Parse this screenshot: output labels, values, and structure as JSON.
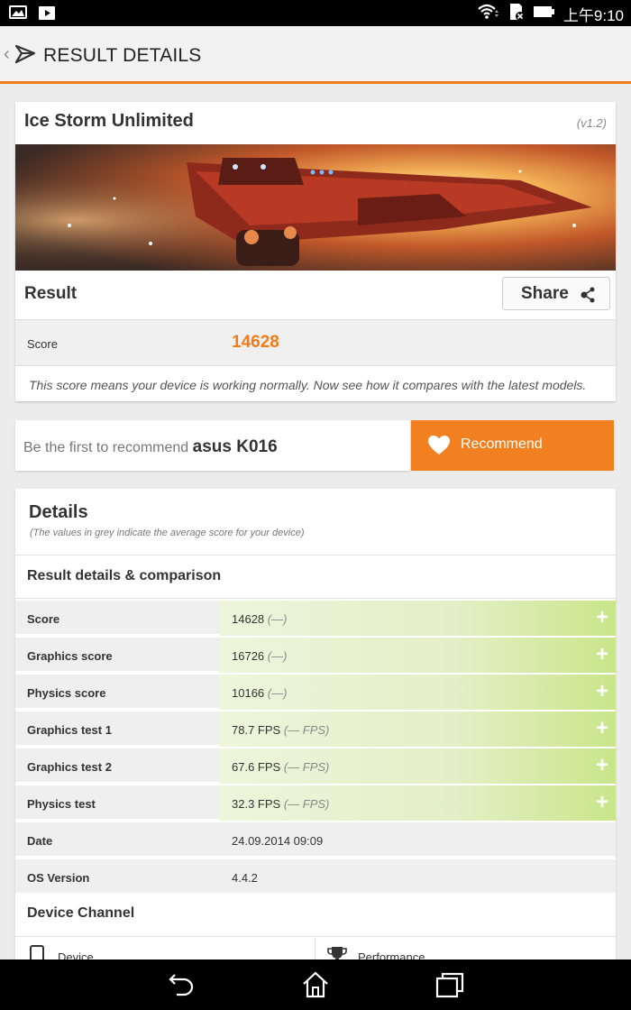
{
  "status_bar": {
    "time": "上午9:10",
    "icons": [
      "image-icon",
      "play-store-icon",
      "wifi-icon",
      "sd-card-icon",
      "battery-icon"
    ]
  },
  "header": {
    "title": "RESULT DETAILS"
  },
  "benchmark": {
    "name": "Ice Storm Unlimited",
    "version": "(v1.2)",
    "result_label": "Result",
    "share_label": "Share",
    "score_label": "Score",
    "score_value": "14628",
    "note": "This score means your device is working normally. Now see how it compares with the latest models."
  },
  "recommend": {
    "prefix": "Be the first to recommend ",
    "device": "asus K016",
    "button_label": "Recommend"
  },
  "details": {
    "title": "Details",
    "subtitle": "(The values in grey indicate the average score for your device)",
    "section_label": "Result details & comparison",
    "rows": [
      {
        "label": "Score",
        "value": "14628",
        "avg": "(—)"
      },
      {
        "label": "Graphics score",
        "value": "16726",
        "avg": "(—)"
      },
      {
        "label": "Physics score",
        "value": "10166",
        "avg": "(—)"
      },
      {
        "label": "Graphics test 1",
        "value": "78.7 FPS",
        "avg": "(— FPS)"
      },
      {
        "label": "Graphics test 2",
        "value": "67.6 FPS",
        "avg": "(— FPS)"
      },
      {
        "label": "Physics test",
        "value": "32.3 FPS",
        "avg": "(— FPS)"
      }
    ],
    "date_label": "Date",
    "date_value": "24.09.2014 09:09",
    "os_label": "OS Version",
    "os_value": "4.4.2",
    "channel_label": "Device Channel",
    "channel_device": "Device",
    "channel_performance": "Performance"
  },
  "colors": {
    "accent": "#f07c1b",
    "recommend_bg": "#f28021",
    "row_value_bg": "#e3efc6"
  }
}
